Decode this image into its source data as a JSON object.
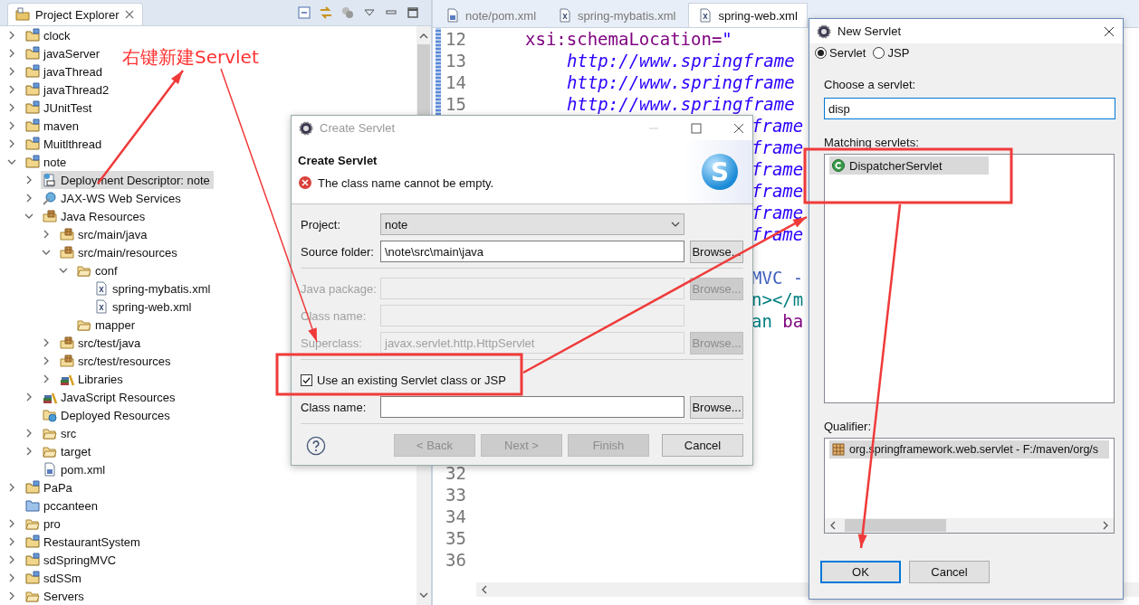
{
  "explorer": {
    "title": "Project Explorer",
    "tree": [
      {
        "label": "clock",
        "kind": "project",
        "expanded": false,
        "selected": false
      },
      {
        "label": "javaServer",
        "kind": "project",
        "expanded": false,
        "selected": false
      },
      {
        "label": "javaThread",
        "kind": "project",
        "expanded": false,
        "selected": false
      },
      {
        "label": "javaThread2",
        "kind": "project",
        "expanded": false,
        "selected": false
      },
      {
        "label": "JUnitTest",
        "kind": "project",
        "expanded": false,
        "selected": false
      },
      {
        "label": "maven",
        "kind": "project",
        "expanded": false,
        "selected": false
      },
      {
        "label": "Muitlthread",
        "kind": "project",
        "expanded": false,
        "selected": false
      },
      {
        "label": "note",
        "kind": "project",
        "expanded": true,
        "selected": false,
        "children": [
          {
            "label": "Deployment Descriptor: note",
            "kind": "descriptor",
            "expanded": false,
            "selected": true
          },
          {
            "label": "JAX-WS Web Services",
            "kind": "webservices",
            "expanded": false,
            "selected": false
          },
          {
            "label": "Java Resources",
            "kind": "source-folder",
            "expanded": true,
            "selected": false,
            "children": [
              {
                "label": "src/main/java",
                "kind": "source-folder",
                "expanded": false,
                "selected": false
              },
              {
                "label": "src/main/resources",
                "kind": "source-folder",
                "expanded": true,
                "selected": false,
                "children": [
                  {
                    "label": "conf",
                    "kind": "folder",
                    "expanded": true,
                    "selected": false,
                    "children": [
                      {
                        "label": "spring-mybatis.xml",
                        "kind": "xml-file",
                        "selected": false
                      },
                      {
                        "label": "spring-web.xml",
                        "kind": "xml-file",
                        "selected": false
                      }
                    ]
                  },
                  {
                    "label": "mapper",
                    "kind": "folder",
                    "selected": false
                  }
                ]
              },
              {
                "label": "src/test/java",
                "kind": "source-folder",
                "expanded": false,
                "selected": false
              },
              {
                "label": "src/test/resources",
                "kind": "source-folder",
                "expanded": false,
                "selected": false
              },
              {
                "label": "Libraries",
                "kind": "library",
                "expanded": false,
                "selected": false
              }
            ]
          },
          {
            "label": "JavaScript Resources",
            "kind": "library",
            "expanded": false,
            "selected": false
          },
          {
            "label": "Deployed Resources",
            "kind": "deployed",
            "selected": false
          },
          {
            "label": "src",
            "kind": "folder",
            "expanded": false,
            "selected": false
          },
          {
            "label": "target",
            "kind": "folder",
            "expanded": false,
            "selected": false
          },
          {
            "label": "pom.xml",
            "kind": "pom-file",
            "selected": false
          }
        ]
      },
      {
        "label": "PaPa",
        "kind": "project",
        "expanded": false,
        "selected": false
      },
      {
        "label": "pccanteen",
        "kind": "plain-folder",
        "selected": false
      },
      {
        "label": "pro",
        "kind": "folder",
        "expanded": false,
        "selected": false
      },
      {
        "label": "RestaurantSystem",
        "kind": "project",
        "expanded": false,
        "selected": false
      },
      {
        "label": "sdSpringMVC",
        "kind": "project",
        "expanded": false,
        "selected": false
      },
      {
        "label": "sdSSm",
        "kind": "project",
        "expanded": false,
        "selected": false
      },
      {
        "label": "Servers",
        "kind": "folder",
        "expanded": false,
        "selected": false
      }
    ]
  },
  "editor": {
    "tabs": [
      {
        "label": "note/pom.xml",
        "kind": "pom-file",
        "selected": false
      },
      {
        "label": "spring-mybatis.xml",
        "kind": "xml-file",
        "selected": false
      },
      {
        "label": "spring-web.xml",
        "kind": "xml-file",
        "selected": true
      }
    ],
    "lines": [
      {
        "kind": "code",
        "number": "12",
        "segments": [
          {
            "text": "xsi:schemaLocation=",
            "kind": "attr"
          },
          {
            "text": "\"",
            "kind": "value"
          }
        ]
      },
      {
        "kind": "continuation",
        "number": "13",
        "segments": [
          {
            "text": "http://www.springframe",
            "kind": "value"
          }
        ]
      },
      {
        "kind": "continuation",
        "number": "14",
        "segments": [
          {
            "text": "http://www.springframe",
            "kind": "value"
          }
        ]
      },
      {
        "kind": "continuation",
        "number": "15",
        "segments": [
          {
            "text": "http://www.springframe",
            "kind": "value"
          }
        ]
      },
      {
        "kind": "tail",
        "segments": [
          {
            "text": "frame",
            "kind": "value"
          }
        ]
      },
      {
        "kind": "tail",
        "segments": [
          {
            "text": "frame",
            "kind": "value"
          }
        ]
      },
      {
        "kind": "tail",
        "segments": [
          {
            "text": "frame",
            "kind": "value"
          }
        ]
      },
      {
        "kind": "tail",
        "segments": [
          {
            "text": "frame",
            "kind": "value"
          }
        ]
      },
      {
        "kind": "tail",
        "segments": [
          {
            "text": "frame",
            "kind": "value"
          }
        ]
      },
      {
        "kind": "tail",
        "segments": [
          {
            "text": "frame",
            "kind": "value"
          }
        ]
      },
      {
        "kind": "blank"
      },
      {
        "kind": "tail",
        "segments": [
          {
            "text": "MVC -",
            "kind": "comment"
          }
        ]
      },
      {
        "kind": "tail",
        "segments": [
          {
            "text": "n></m",
            "kind": "tag"
          }
        ]
      },
      {
        "kind": "tail",
        "segments": [
          {
            "text": "an ",
            "kind": "tag"
          },
          {
            "text": "ba",
            "kind": "attr"
          }
        ]
      },
      {
        "kind": "blank"
      },
      {
        "kind": "blank"
      },
      {
        "kind": "blank"
      },
      {
        "kind": "blank"
      },
      {
        "kind": "blank"
      },
      {
        "kind": "blank"
      },
      {
        "kind": "blank",
        "number": "32"
      },
      {
        "kind": "blank",
        "number": "33"
      },
      {
        "kind": "blank",
        "number": "34"
      },
      {
        "kind": "blank",
        "number": "35"
      },
      {
        "kind": "blank",
        "number": "36"
      }
    ]
  },
  "create_servlet": {
    "title": "Create Servlet",
    "heading": "Create Servlet",
    "error": "The class name cannot be empty.",
    "logo": "S",
    "sections": [
      {
        "fields": [
          {
            "kind": "dropdown",
            "label": "Project:",
            "value": "note",
            "disabled": false
          },
          {
            "kind": "text",
            "label": "Source folder:",
            "value": "\\note\\src\\main\\java",
            "disabled": false,
            "browse": {
              "label": "Browse...",
              "disabled": false
            }
          }
        ]
      },
      {
        "fields": [
          {
            "kind": "text",
            "label": "Java package:",
            "disabled": true,
            "browse": {
              "label": "Browse...",
              "disabled": true
            }
          },
          {
            "kind": "text",
            "label": "Class name:",
            "disabled": true
          },
          {
            "kind": "text",
            "label": "Superclass:",
            "value": "javax.servlet.http.HttpServlet",
            "disabled": true,
            "browse": {
              "label": "Browse...",
              "disabled": true
            }
          }
        ]
      },
      {
        "fields": [
          {
            "kind": "checkbox",
            "label": "Use an existing Servlet class or JSP",
            "checked": true,
            "disabled": false
          },
          {
            "kind": "text",
            "label": "Class name:",
            "disabled": false,
            "browse": {
              "label": "Browse...",
              "disabled": false
            }
          }
        ]
      }
    ],
    "buttons": [
      {
        "label": "< Back",
        "disabled": true
      },
      {
        "label": "Next >",
        "disabled": true
      },
      {
        "label": "Finish",
        "disabled": true
      },
      {
        "label": "Cancel",
        "disabled": false
      }
    ]
  },
  "new_servlet": {
    "title": "New Servlet",
    "types": [
      {
        "label": "Servlet",
        "selected": true
      },
      {
        "label": "JSP",
        "selected": false
      }
    ],
    "choose_label": "Choose a servlet:",
    "filter": "disp",
    "matching_label": "Matching servlets:",
    "matches": [
      {
        "label": "DispatcherServlet",
        "selected": true
      }
    ],
    "qualifier_label": "Qualifier:",
    "qualifiers": [
      {
        "label": "org.springframework.web.servlet - F:/maven/org/s",
        "selected": true
      }
    ],
    "buttons": [
      {
        "label": "OK",
        "default": true
      },
      {
        "label": "Cancel",
        "default": false
      }
    ]
  },
  "annotation": {
    "caption": "右键新建Servlet"
  }
}
